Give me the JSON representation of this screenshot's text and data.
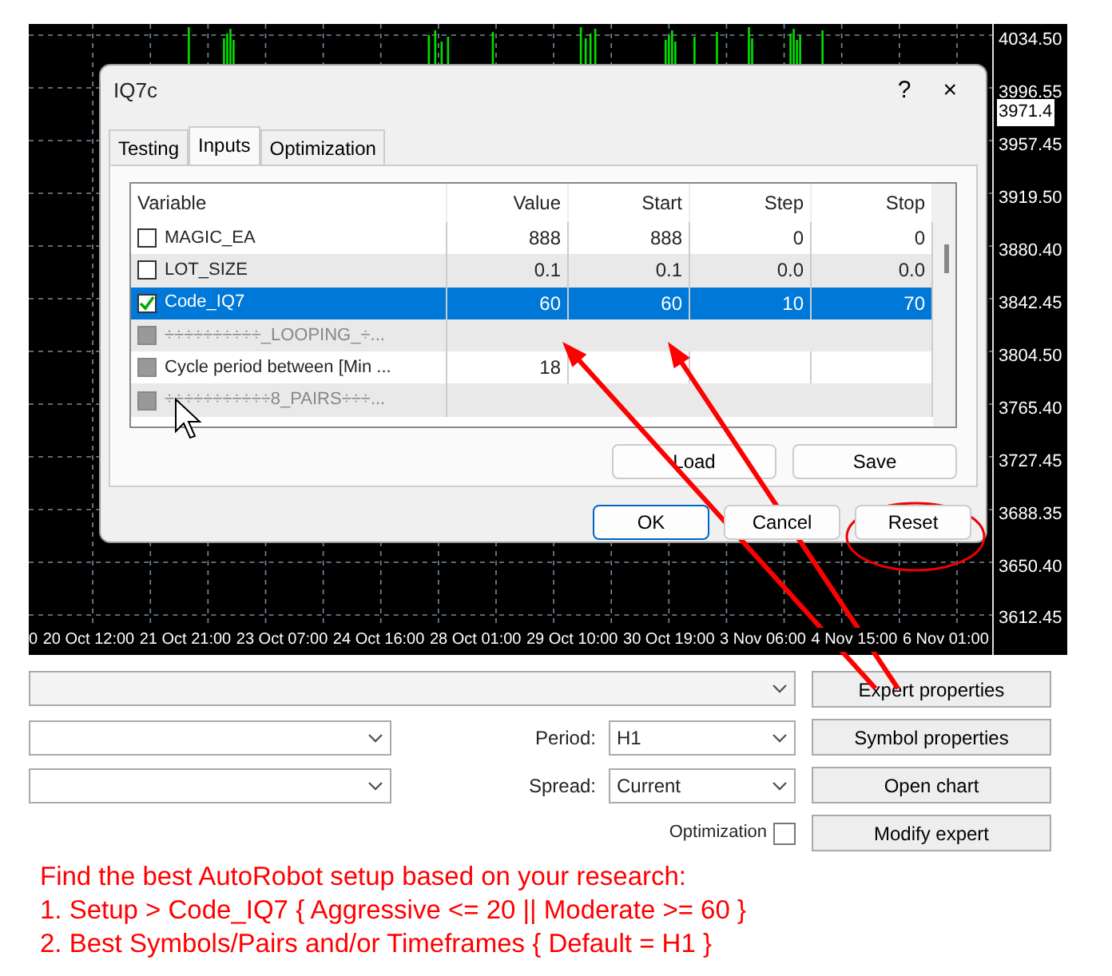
{
  "chart": {
    "price_labels": [
      "4034.50",
      "3996.55",
      "3957.45",
      "3919.50",
      "3880.40",
      "3842.45",
      "3804.50",
      "3765.40",
      "3727.45",
      "3688.35",
      "3650.40",
      "3612.45"
    ],
    "current_price": "3971.4",
    "time_labels": [
      "0",
      "20 Oct 12:00",
      "21 Oct 21:00",
      "23 Oct 07:00",
      "24 Oct 16:00",
      "28 Oct 01:00",
      "29 Oct 10:00",
      "30 Oct 19:00",
      "3 Nov 06:00",
      "4 Nov 15:00",
      "6 Nov 01:00"
    ]
  },
  "dialog": {
    "title": "IQ7c",
    "help": "?",
    "close": "×",
    "tabs": [
      {
        "label": "Testing",
        "selected": false
      },
      {
        "label": "Inputs",
        "selected": true
      },
      {
        "label": "Optimization",
        "selected": false
      }
    ],
    "table": {
      "columns": [
        "Variable",
        "Value",
        "Start",
        "Step",
        "Stop"
      ],
      "rows": [
        {
          "kind": "param",
          "checked": false,
          "disabled": false,
          "selected": false,
          "cells": [
            "MAGIC_EA",
            "888",
            "888",
            "0",
            "0"
          ]
        },
        {
          "kind": "param",
          "checked": false,
          "disabled": false,
          "selected": false,
          "cells": [
            "LOT_SIZE",
            "0.1",
            "0.1",
            "0.0",
            "0.0"
          ]
        },
        {
          "kind": "param",
          "checked": true,
          "disabled": false,
          "selected": true,
          "cells": [
            "Code_IQ7",
            "60",
            "60",
            "10",
            "70"
          ]
        },
        {
          "kind": "separator",
          "checked": false,
          "disabled": true,
          "selected": false,
          "cells": [
            "÷÷÷÷÷÷÷÷÷÷_LOOPING_÷..."
          ]
        },
        {
          "kind": "param",
          "checked": false,
          "disabled": true,
          "selected": false,
          "cells": [
            "Cycle period between [Min ...",
            "18"
          ]
        },
        {
          "kind": "separator",
          "checked": false,
          "disabled": true,
          "selected": false,
          "cells": [
            "÷÷÷÷÷÷÷÷÷÷÷8_PAIRS÷÷÷..."
          ]
        }
      ]
    },
    "side_buttons": [
      "Load",
      "Save"
    ],
    "buttons": [
      {
        "label": "OK",
        "default": true
      },
      {
        "label": "Cancel",
        "default": false
      },
      {
        "label": "Reset",
        "default": false
      }
    ]
  },
  "tester": {
    "fields": [
      {
        "label": "Period:",
        "value": "H1"
      },
      {
        "label": "Spread:",
        "value": "Current"
      }
    ],
    "optimization": {
      "label": "Optimization",
      "checked": false
    },
    "buttons": [
      "Expert properties",
      "Symbol properties",
      "Open chart",
      "Modify expert"
    ]
  },
  "annotation": {
    "lines": [
      "Find the best AutoRobot setup based on your research:",
      "1. Setup > Code_IQ7 { Aggressive <= 20 || Moderate >= 60 }",
      "2. Best Symbols/Pairs and/or Timeframes { Default = H1 }"
    ]
  }
}
